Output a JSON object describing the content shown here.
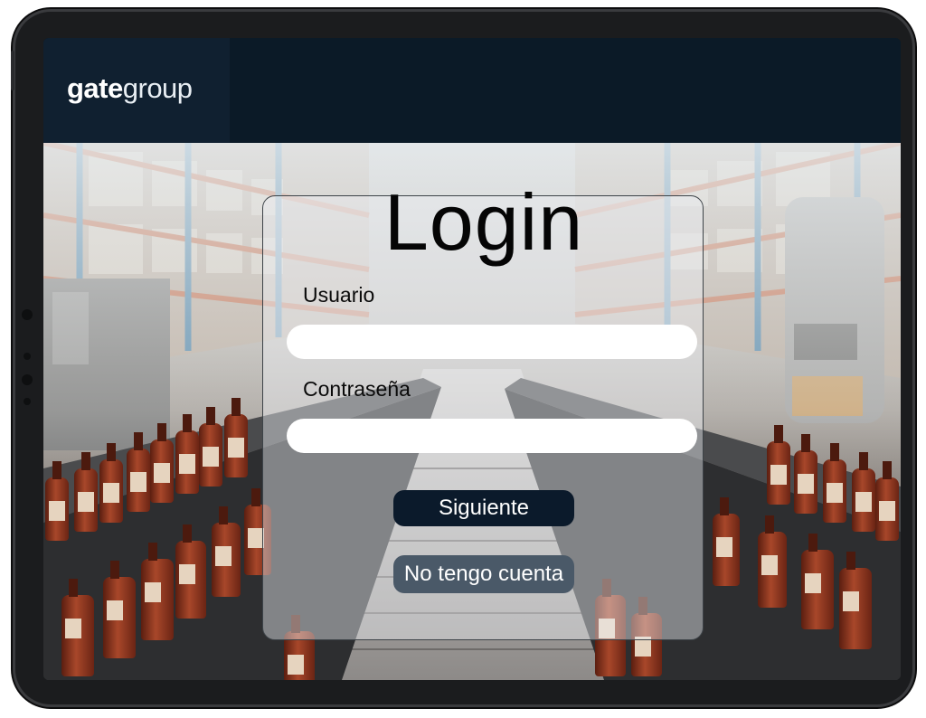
{
  "brand": {
    "logo_bold": "gate",
    "logo_light": "group"
  },
  "login": {
    "title": "Login",
    "username_label": "Usuario",
    "username_value": "",
    "password_label": "Contraseña",
    "password_value": "",
    "next_button": "Siguiente",
    "no_account_button": "No tengo cuenta"
  },
  "colors": {
    "header": "#0b1a27",
    "primary_button": "#0b1a2b",
    "secondary_button": "#4a5968"
  }
}
